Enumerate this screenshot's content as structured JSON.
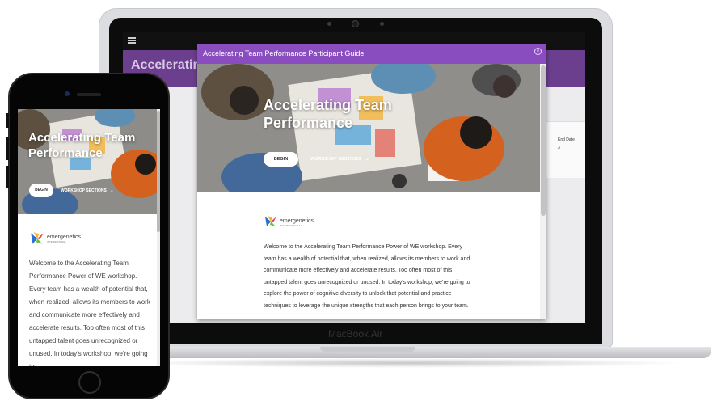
{
  "laptop": {
    "brand": "MacBook Air",
    "app_banner_title": "Accelerating Te",
    "end_date_label": "End Date",
    "end_date_value": "3"
  },
  "modal": {
    "title": "Accelerating Team Performance Participant Guide",
    "close_icon": "close-icon",
    "hero_title_line1": "Accelerating Team",
    "hero_title_line2": "Performance",
    "begin_label": "BEGIN",
    "sections_label": "WORKSHOP SECTIONS",
    "logo_name": "emergenetics",
    "logo_sub": "INTERNATIONAL",
    "body": "Welcome to the Accelerating Team Performance Power of WE workshop. Every team has a wealth of potential that, when realized, allows its members to work and communicate more effectively and accelerate results. Too often most of this untapped talent goes unrecognized or unused. In today’s workshop, we’re going to explore the power of cognitive diversity to unlock that potential and practice techniques to leverage the unique strengths that each person brings to your team."
  },
  "phone": {
    "hero_title_line1": "Accelerating Team",
    "hero_title_line2": "Performance",
    "begin_label": "BEGIN",
    "sections_label": "WORKSHOP SECTIONS",
    "logo_name": "emergenetics",
    "logo_sub": "INTERNATIONAL",
    "body": "Welcome to the Accelerating Team Performance Power of WE workshop. Every team has a wealth of potential that, when realized, allows its members to work and communicate more effectively and accelerate results. Too often most of this untapped talent goes unrecognized or unused. In today’s workshop, we’re going to"
  },
  "colors": {
    "modal_header": "#8a4dc0",
    "app_banner": "#6c3f8e",
    "logo_blue": "#2f6fd1",
    "logo_red": "#e5483a",
    "logo_green": "#6cbf3a",
    "logo_yellow": "#f4b32b"
  }
}
